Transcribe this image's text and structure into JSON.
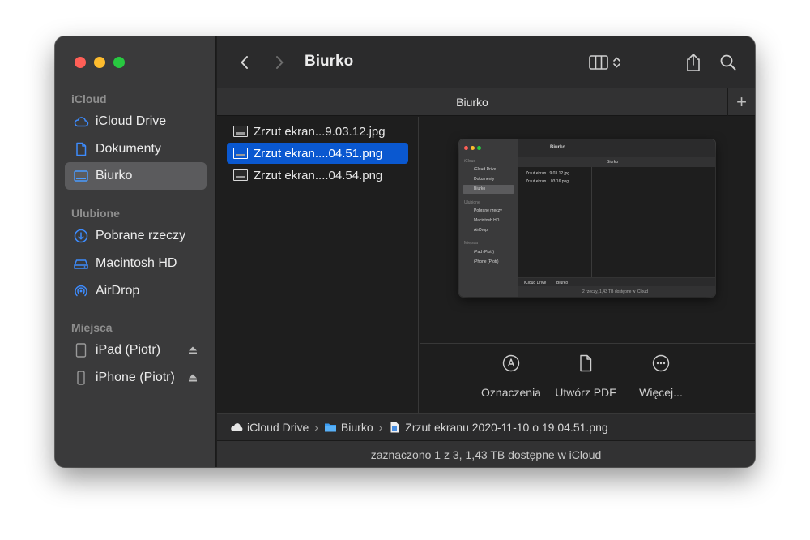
{
  "sidebar": {
    "sections": [
      {
        "title": "iCloud",
        "items": [
          {
            "label": "iCloud Drive",
            "icon": "cloud-icon"
          },
          {
            "label": "Dokumenty",
            "icon": "document-icon"
          },
          {
            "label": "Biurko",
            "icon": "desktop-icon",
            "active": true
          }
        ]
      },
      {
        "title": "Ulubione",
        "items": [
          {
            "label": "Pobrane rzeczy",
            "icon": "download-icon"
          },
          {
            "label": "Macintosh HD",
            "icon": "harddisk-icon"
          },
          {
            "label": "AirDrop",
            "icon": "airdrop-icon"
          }
        ]
      },
      {
        "title": "Miejsca",
        "items": [
          {
            "label": "iPad (Piotr)",
            "icon": "ipad-icon",
            "eject": true
          },
          {
            "label": "iPhone (Piotr)",
            "icon": "iphone-icon",
            "eject": true
          }
        ]
      }
    ]
  },
  "toolbar": {
    "title": "Biurko"
  },
  "tabbar": {
    "title": "Biurko",
    "add_label": "+"
  },
  "files": [
    {
      "name": "Zrzut ekran...9.03.12.jpg",
      "selected": false
    },
    {
      "name": "Zrzut ekran....04.51.png",
      "selected": true
    },
    {
      "name": "Zrzut ekran....04.54.png",
      "selected": false
    }
  ],
  "preview_actions": [
    {
      "label": "Oznaczenia",
      "icon": "markup-icon"
    },
    {
      "label": "Utwórz PDF",
      "icon": "create-pdf-icon"
    },
    {
      "label": "Więcej...",
      "icon": "more-icon"
    }
  ],
  "pathbar": {
    "segments": [
      "iCloud Drive",
      "Biurko",
      "Zrzut ekranu 2020-11-10 o 19.04.51.png"
    ]
  },
  "statusbar": {
    "text": "zaznaczono 1 z 3, 1,43 TB dostępne w iCloud"
  },
  "preview_thumbnail": {
    "toolbar_title": "Biurko",
    "tab_title": "Biurko",
    "sidebar_sections": [
      "iCloud",
      "Ulubione",
      "Miejsca"
    ],
    "sidebar_items": [
      "iCloud Drive",
      "Dokumenty",
      "Biurko",
      "Pobrane rzeczy",
      "Macintosh HD",
      "AirDrop",
      "iPad (Piotr)",
      "iPhone (Piotr)"
    ],
    "files": [
      "Zrzut ekran...9.03.12.jpg",
      "Zrzut ekran....03.16.png"
    ],
    "pathbar": [
      "iCloud Drive",
      "Biurko"
    ],
    "status": "2 rzeczy, 1,43 TB dostępne w iCloud"
  }
}
